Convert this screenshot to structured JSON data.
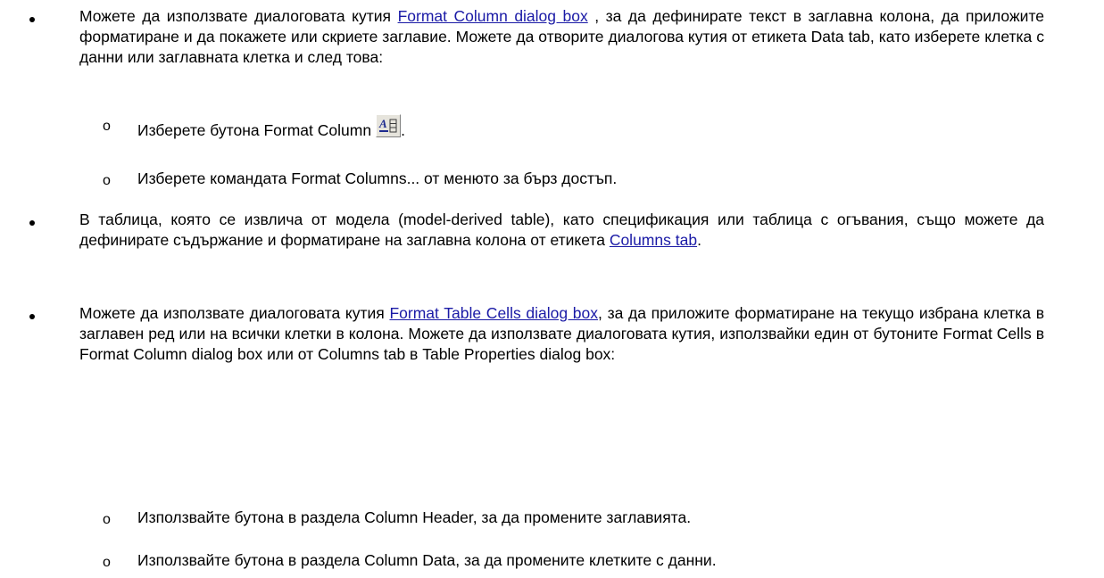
{
  "bullets": [
    {
      "parts": {
        "pre": "Можете да използвате диалоговата кутия ",
        "link": "Format Column dialog box",
        "post": " , за да дефинирате текст в заглавна колона, да приложите форматиране и да покажете или скриете заглавие. Можете да отворите диалогова кутия от етикета Data tab, като изберете клетка с данни или заглавната клетка и след това:"
      },
      "subitems": [
        {
          "text": "Изберете бутона Format Column",
          "icon": "format-column-icon"
        },
        {
          "text": "Изберете командата Format Columns... от менюто за бърз достъп."
        }
      ]
    },
    {
      "parts": {
        "pre": "В таблица, която се извлича от модела (model-derived table), като спецификация или таблица с огъвания, също можете да дефинирате съдържание и форматиране на заглавна колона от етикета ",
        "link": "Columns tab",
        "post": "."
      }
    },
    {
      "parts": {
        "pre": "Можете да използвате диалоговата кутия ",
        "link": "Format Table Cells dialog box",
        "post": ", за да приложите форматиране на текущо избрана клетка в заглавен ред или на всички клетки в колона. Можете да използвате диалоговата кутия, използвайки един от бутоните Format Cells в Format Column dialog box или от Columns tab в Table Properties dialog box:"
      },
      "subitems": [
        {
          "text": "Използвайте бутона в раздела Column Header, за да промените заглавията."
        },
        {
          "text": "Използвайте бутона в раздела Column Data, за да промените клетките с данни."
        }
      ]
    }
  ],
  "sub_marker": "o",
  "icon_tail": ".",
  "colors": {
    "link": "#1a1aa6",
    "text": "#000000",
    "background": "#ffffff"
  }
}
